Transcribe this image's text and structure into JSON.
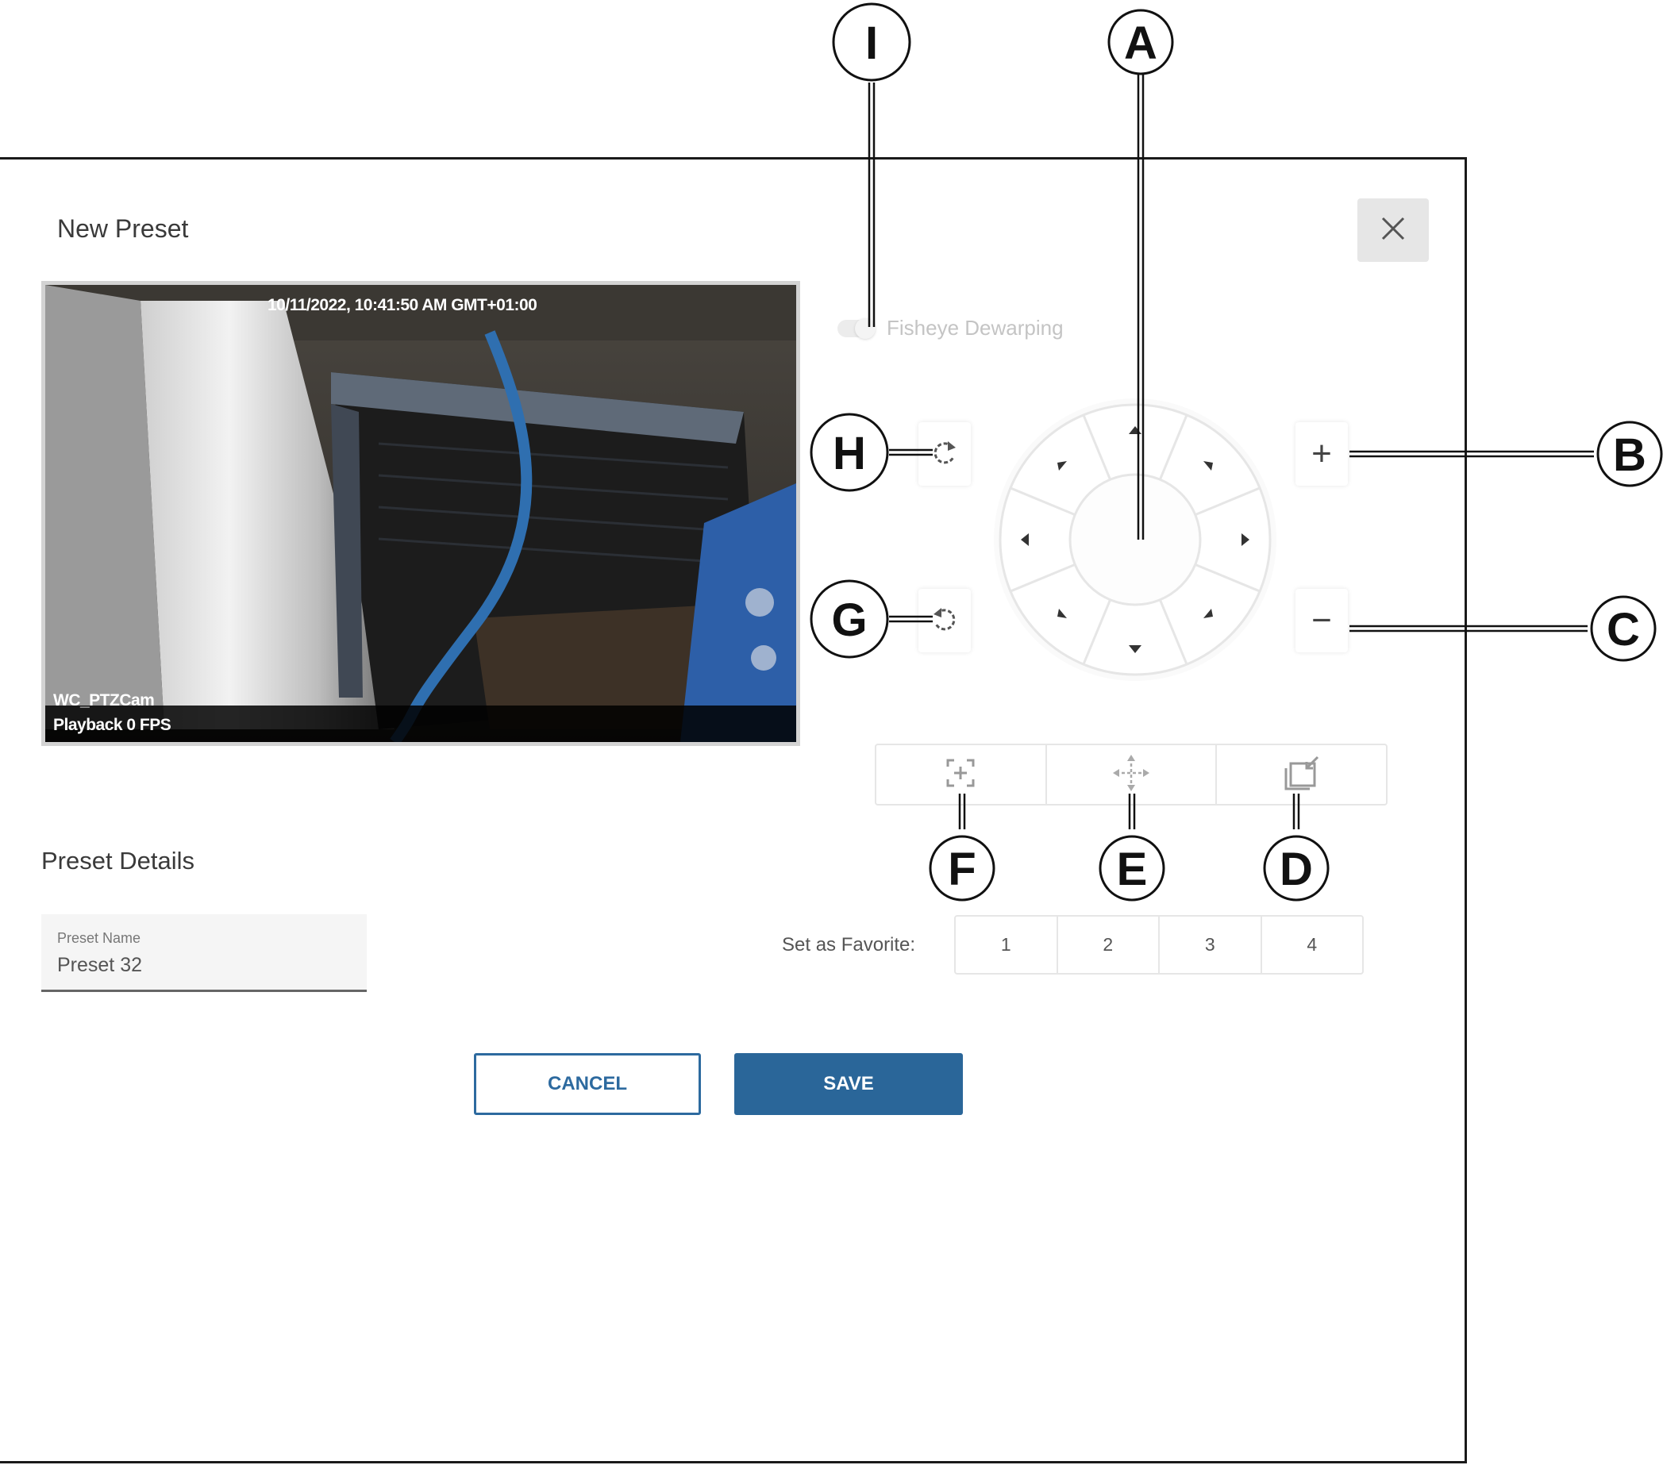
{
  "dialog": {
    "title": "New Preset",
    "close_icon": "close-icon"
  },
  "video": {
    "timestamp": "10/11/2022, 10:41:50 AM GMT+01:00",
    "camera_name": "WC_PTZCam",
    "playback_status": "Playback 0 FPS"
  },
  "fisheye": {
    "label": "Fisheye Dewarping",
    "enabled": false
  },
  "ptz": {
    "rotate_cw_icon": "rotate-clockwise-icon",
    "rotate_ccw_icon": "rotate-counterclockwise-icon",
    "zoom_in_label": "+",
    "zoom_out_label": "−",
    "joystick_directions": [
      "up",
      "up-right",
      "right",
      "down-right",
      "down",
      "down-left",
      "left",
      "up-left"
    ],
    "actions": [
      "focus-add-icon",
      "move-arrows-icon",
      "window-snapshot-icon"
    ]
  },
  "details": {
    "title": "Preset Details",
    "name_label": "Preset Name",
    "name_value": "Preset 32"
  },
  "favorite": {
    "label": "Set as Favorite:",
    "options": [
      "1",
      "2",
      "3",
      "4"
    ]
  },
  "buttons": {
    "cancel": "CANCEL",
    "save": "SAVE"
  },
  "callouts": {
    "a": "A",
    "b": "B",
    "c": "C",
    "d": "D",
    "e": "E",
    "f": "F",
    "g": "G",
    "h": "H",
    "i": "I"
  },
  "colors": {
    "primary": "#2a6699",
    "dialog_border": "#1a1a1a",
    "disabled_text": "#c4c4c4"
  }
}
